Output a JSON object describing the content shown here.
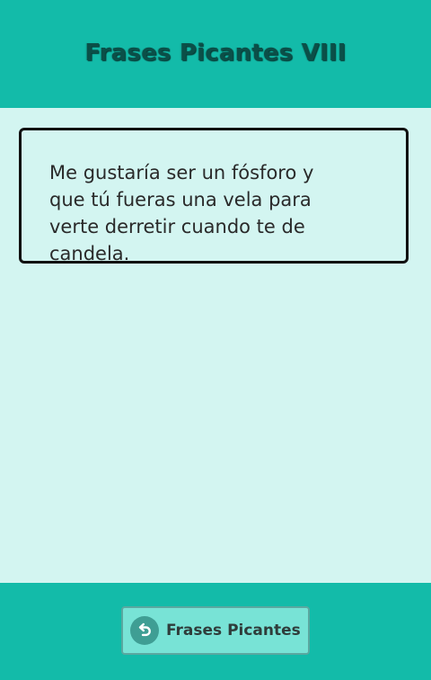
{
  "header": {
    "title": "Frases Picantes VIII"
  },
  "card": {
    "text": "Me gustaría ser un fósforo y que tú fueras una vela para verte derretir cuando te de candela."
  },
  "footer": {
    "back_button_label": "Frases Picantes",
    "back_icon": "undo-arrow-icon"
  },
  "colors": {
    "header_bg": "#13bba9",
    "content_bg": "#d3f5f1",
    "button_bg": "#78e3d6"
  }
}
